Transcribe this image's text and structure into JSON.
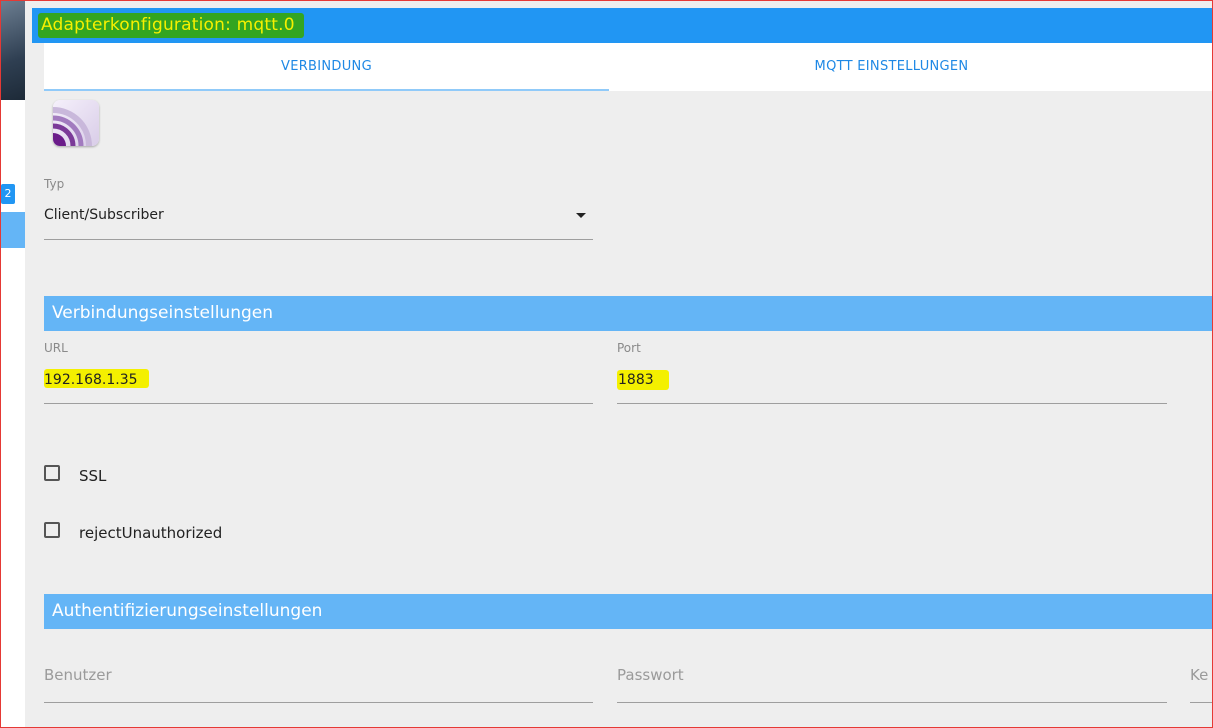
{
  "window": {
    "title": "Adapterkonfiguration: mqtt.0"
  },
  "sidebar": {
    "badge": "2"
  },
  "tabs": [
    {
      "label": "VERBINDUNG",
      "active": true
    },
    {
      "label": "MQTT EINSTELLUNGEN",
      "active": false
    }
  ],
  "adapter_icon": "mqtt-logo-icon",
  "type_field": {
    "label": "Typ",
    "value": "Client/Subscriber"
  },
  "connection_section": {
    "title": "Verbindungseinstellungen",
    "url": {
      "label": "URL",
      "value": "192.168.1.35"
    },
    "port": {
      "label": "Port",
      "value": "1883"
    },
    "ssl": {
      "label": "SSL",
      "checked": false
    },
    "reject": {
      "label": "rejectUnauthorized",
      "checked": false
    }
  },
  "auth_section": {
    "title": "Authentifizierungseinstellungen",
    "user": {
      "placeholder": "Benutzer"
    },
    "password": {
      "placeholder": "Passwort"
    },
    "third": {
      "placeholder": "Ke"
    }
  },
  "colors": {
    "header": "#2196f3",
    "section": "#64b5f6",
    "highlight": "#f4f000",
    "title_highlight": "#33a521"
  }
}
